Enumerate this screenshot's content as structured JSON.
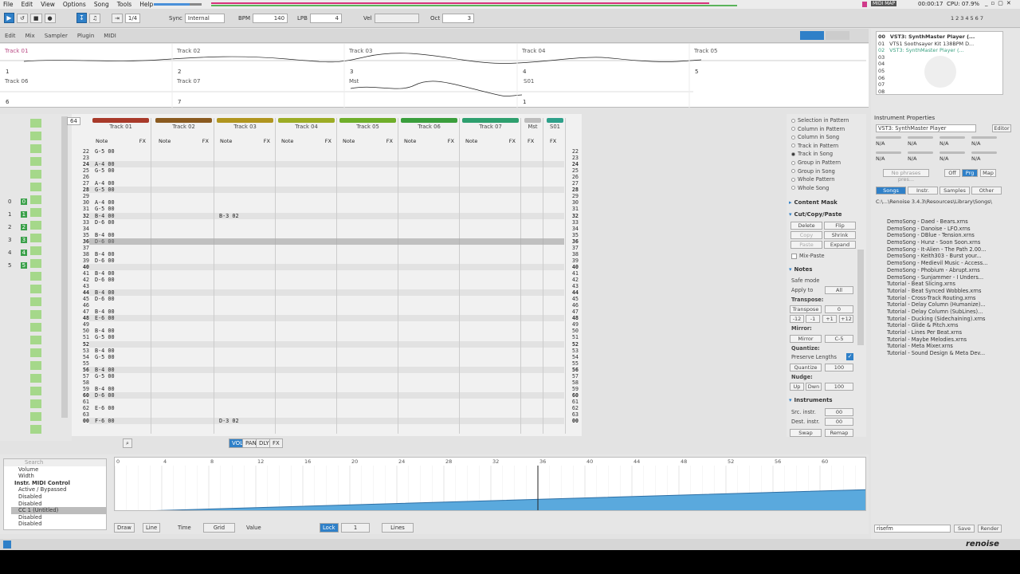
{
  "menu": [
    "File",
    "Edit",
    "View",
    "Options",
    "Song",
    "Tools",
    "Help"
  ],
  "status": {
    "midi_map": "MIDI MAP",
    "time": "00:00:17",
    "cpu": "CPU: 07.9%"
  },
  "toolbar": {
    "step_value": "1/4",
    "sync_label": "Sync",
    "sync_value": "Internal",
    "bpm_label": "BPM",
    "bpm_value": "140",
    "lpb_label": "LPB",
    "lpb_value": "4",
    "vel_label": "Vel",
    "oct_label": "Oct",
    "oct_value": "3",
    "pattern_number": "64"
  },
  "tabs": [
    "Edit",
    "Mix",
    "Sampler",
    "Plugin",
    "MIDI"
  ],
  "scope": {
    "tracks_row1": [
      {
        "name": "Track 01",
        "num": "1"
      },
      {
        "name": "Track 02",
        "num": "2"
      },
      {
        "name": "Track 03",
        "num": "3"
      },
      {
        "name": "Track 04",
        "num": "4"
      },
      {
        "name": "Track 05",
        "num": "5"
      }
    ],
    "tracks_row2": [
      {
        "name": "Track 06",
        "num": "6"
      },
      {
        "name": "Track 07",
        "num": "7"
      },
      {
        "name": "Mst",
        "num": "3"
      },
      {
        "name": "S01",
        "num": "1"
      }
    ]
  },
  "pattern_tracks": [
    {
      "name": "Track 01",
      "color": "#a83a2a"
    },
    {
      "name": "Track 02",
      "color": "#8a5a20"
    },
    {
      "name": "Track 03",
      "color": "#b0951f"
    },
    {
      "name": "Track 04",
      "color": "#9cac25"
    },
    {
      "name": "Track 05",
      "color": "#6fae2a"
    },
    {
      "name": "Track 06",
      "color": "#3a9e3c"
    },
    {
      "name": "Track 07",
      "color": "#2e9f6e"
    },
    {
      "name": "Mst",
      "color": "#bdbdbd"
    },
    {
      "name": "S01",
      "color": "#2ea08a"
    }
  ],
  "pattern_labels": {
    "play": "PLAY",
    "note": "Note",
    "fx": "FX"
  },
  "rows": [
    {
      "n": "22",
      "t1": "G-5 00"
    },
    {
      "n": "23",
      "t1": ""
    },
    {
      "n": "24",
      "t1": "A-4 00"
    },
    {
      "n": "25",
      "t1": "G-5 00"
    },
    {
      "n": "26",
      "t1": ""
    },
    {
      "n": "27",
      "t1": "A-4 00"
    },
    {
      "n": "28",
      "t1": "G-5 00"
    },
    {
      "n": "29",
      "t1": ""
    },
    {
      "n": "30",
      "t1": "A-4 00"
    },
    {
      "n": "31",
      "t1": "G-5 00"
    },
    {
      "n": "32",
      "t1": "B-4 00",
      "t3": "B-3 02"
    },
    {
      "n": "33",
      "t1": "D-6 00"
    },
    {
      "n": "34",
      "t1": ""
    },
    {
      "n": "35",
      "t1": "B-4 00"
    },
    {
      "n": "36",
      "t1": "D-6 00"
    },
    {
      "n": "37",
      "t1": ""
    },
    {
      "n": "38",
      "t1": "B-4 00"
    },
    {
      "n": "39",
      "t1": "D-6 00"
    },
    {
      "n": "40",
      "t1": ""
    },
    {
      "n": "41",
      "t1": "B-4 00"
    },
    {
      "n": "42",
      "t1": "D-6 00"
    },
    {
      "n": "43",
      "t1": ""
    },
    {
      "n": "44",
      "t1": "B-4 00"
    },
    {
      "n": "45",
      "t1": "D-6 00"
    },
    {
      "n": "46",
      "t1": ""
    },
    {
      "n": "47",
      "t1": "B-4 00"
    },
    {
      "n": "48",
      "t1": "E-6 00"
    },
    {
      "n": "49",
      "t1": ""
    },
    {
      "n": "50",
      "t1": "B-4 00"
    },
    {
      "n": "51",
      "t1": "G-5 00"
    },
    {
      "n": "52",
      "t1": ""
    },
    {
      "n": "53",
      "t1": "B-4 00"
    },
    {
      "n": "54",
      "t1": "G-5 00"
    },
    {
      "n": "55",
      "t1": ""
    },
    {
      "n": "56",
      "t1": "B-4 00"
    },
    {
      "n": "57",
      "t1": "G-5 00"
    },
    {
      "n": "58",
      "t1": ""
    },
    {
      "n": "59",
      "t1": "B-4 00"
    },
    {
      "n": "60",
      "t1": "D-6 00"
    },
    {
      "n": "61",
      "t1": ""
    },
    {
      "n": "62",
      "t1": "E-6 00"
    },
    {
      "n": "63",
      "t1": ""
    },
    {
      "n": "00",
      "t1": "F-6 00",
      "t3": "D-3 02"
    }
  ],
  "side_selection": [
    "Selection in Pattern",
    "Column in Pattern",
    "Column in Song",
    "Track in Pattern",
    "Track in Song",
    "Group in Pattern",
    "Group in Song",
    "Whole Pattern",
    "Whole Song"
  ],
  "side_sections": {
    "content_mask": "Content Mask",
    "cut_copy_paste": "Cut/Copy/Paste",
    "notes": "Notes",
    "instruments": "Instruments"
  },
  "side_buttons": {
    "delete": "Delete",
    "flip": "Flip",
    "copy": "Copy",
    "shrink": "Shrink",
    "paste": "Paste",
    "expand": "Expand",
    "mix_paste": "Mix-Paste"
  },
  "notes": {
    "safe_mode": "Safe mode",
    "apply_to": "Apply to",
    "apply_value": "All",
    "transpose_label": "Transpose:",
    "transpose_btn": "Transpose",
    "transpose_value": "0",
    "m12": "-12",
    "m1": "-1",
    "p1": "+1",
    "p12": "+12",
    "mirror_label": "Mirror:",
    "mirror_btn": "Mirror",
    "mirror_value": "C-5",
    "quantize_label": "Quantize:",
    "preserve": "Preserve Lengths",
    "quantize_btn": "Quantize",
    "quantize_value": "100",
    "nudge_label": "Nudge:",
    "up": "Up",
    "dwn": "Dwn",
    "nudge_value": "100"
  },
  "instruments": {
    "src": "Src. instr.",
    "src_val": "00",
    "dest": "Dest. instr.",
    "dest_val": "00",
    "swap": "Swap",
    "remap": "Remap"
  },
  "inst_list": [
    {
      "idx": "00",
      "name": "VST3: SynthMaster Player (..."
    },
    {
      "idx": "01",
      "name": "VTS1 Soothsayer Kit 138BPM D..."
    },
    {
      "idx": "02",
      "name": "VST3: SynthMaster Player (..."
    },
    {
      "idx": "03",
      "name": ""
    },
    {
      "idx": "04",
      "name": ""
    },
    {
      "idx": "05",
      "name": ""
    },
    {
      "idx": "06",
      "name": ""
    },
    {
      "idx": "07",
      "name": ""
    },
    {
      "idx": "08",
      "name": ""
    }
  ],
  "inst_props": {
    "title": "Instrument Properties",
    "plugin": "VST3: SynthMaster Player",
    "editor": "Editor",
    "na": "N/A",
    "phrases": "No phrases pres...",
    "off": "Off",
    "prg": "Prg",
    "map": "Map"
  },
  "browser": {
    "tabs": [
      "Songs",
      "Instr.",
      "Samples",
      "Other"
    ],
    "path": "C:\\...\\Renoise 3.4.3\\Resources\\Library\\Songs\\",
    "files": [
      "DemoSong - Daed - Bears.xrns",
      "DemoSong - Danoise - LFO.xrns",
      "DemoSong - DBlue - Tension.xrns",
      "DemoSong - Hunz - Soon Soon.xrns",
      "DemoSong - It-Alien - The Path 2.00...",
      "DemoSong - Keith303 - Burst your...",
      "DemoSong - Medievil Music - Access...",
      "DemoSong - Phobium - Abrupt.xrns",
      "DemoSong - Sunjammer - I Unders...",
      "Tutorial - Beat Slicing.xrns",
      "Tutorial - Beat Synced Wobbles.xrns",
      "Tutorial - Cross-Track Routing.xrns",
      "Tutorial - Delay Column (Humanize)...",
      "Tutorial - Delay Column (SubLines)...",
      "Tutorial - Ducking (Sidechaining).xrns",
      "Tutorial - Glide & Pitch.xrns",
      "Tutorial - Lines Per Beat.xrns",
      "Tutorial - Maybe Melodies.xrns",
      "Tutorial - Meta Mixer.xrns",
      "Tutorial - Sound Design & Meta Dev..."
    ],
    "save_name": "risefm",
    "save": "Save",
    "render": "Render"
  },
  "automation": {
    "search_placeholder": "Search",
    "params": [
      "Volume",
      "Width",
      "Instr. MIDI Control",
      "Active / Bypassed",
      "Disabled",
      "Disabled",
      "CC 1 (Untitled)",
      "Disabled",
      "Disabled"
    ],
    "ruler": [
      "0",
      "4",
      "8",
      "12",
      "16",
      "20",
      "24",
      "28",
      "32",
      "36",
      "40",
      "44",
      "48",
      "52",
      "56",
      "60"
    ],
    "draw": "Draw",
    "line": "Line",
    "time": "Time",
    "grid": "Grid",
    "value": "Value",
    "lock": "Lock",
    "lock_val": "1",
    "lines": "Lines"
  },
  "automation_data": {
    "start_value": 0.0,
    "end_value": 0.48,
    "playhead_line": 36
  }
}
